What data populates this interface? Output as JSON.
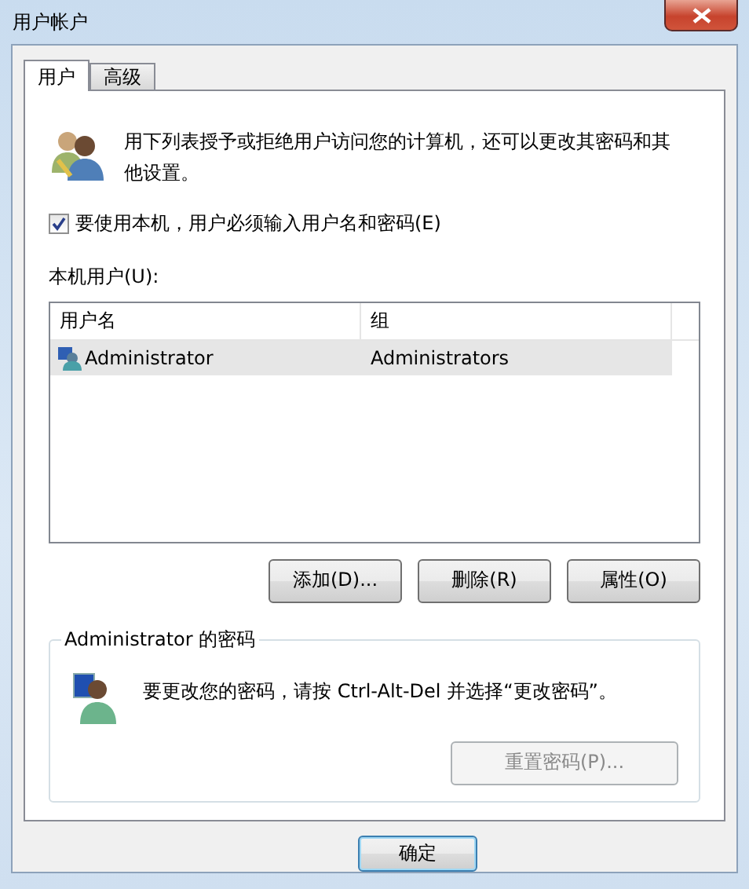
{
  "window": {
    "title": "用户帐户"
  },
  "tabs": [
    {
      "label": "用户",
      "selected": true
    },
    {
      "label": "高级",
      "selected": false
    }
  ],
  "intro": "用下列表授予或拒绝用户访问您的计算机，还可以更改其密码和其他设置。",
  "require_password": {
    "label": "要使用本机，用户必须输入用户名和密码(E)",
    "checked": true
  },
  "users_label": "本机用户(U):",
  "table": {
    "columns": [
      "用户名",
      "组"
    ],
    "rows": [
      {
        "cells": [
          "Administrator",
          "Administrators"
        ],
        "selected": true
      }
    ]
  },
  "buttons": [
    {
      "label": "添加(D)...",
      "disabled": false
    },
    {
      "label": "删除(R)",
      "disabled": false
    },
    {
      "label": "属性(O)",
      "disabled": false
    }
  ],
  "password_group": {
    "title": "Administrator 的密码",
    "text": "要更改您的密码，请按 Ctrl-Alt-Del 并选择“更改密码”。",
    "reset_button": {
      "label": "重置密码(P)...",
      "disabled": true
    }
  },
  "dialog_buttons": [
    {
      "label": "确定",
      "default": true
    }
  ]
}
